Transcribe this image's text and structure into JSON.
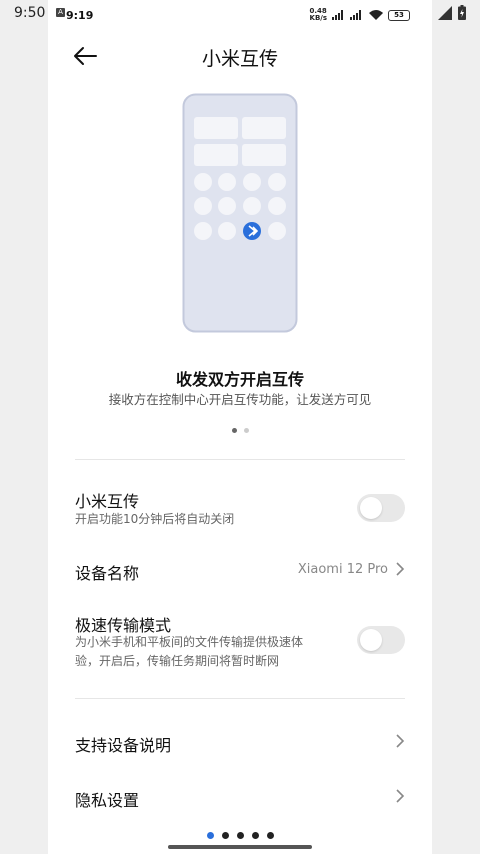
{
  "outer_status": {
    "time": "9:50"
  },
  "inner_status": {
    "time": "9:19",
    "net_speed_top": "0.48",
    "net_speed_bottom": "KB/s",
    "battery": "53"
  },
  "header": {
    "title": "小米互传"
  },
  "slide": {
    "title": "收发双方开启互传",
    "description": "接收方在控制中心开启互传功能，让发送方可见",
    "page_count": 2,
    "active_page": 1
  },
  "settings": {
    "mi_share": {
      "label": "小米互传",
      "sub": "开启功能10分钟后将自动关闭",
      "enabled": false
    },
    "device_name": {
      "label": "设备名称",
      "value": "Xiaomi 12 Pro"
    },
    "fast_mode": {
      "label": "极速传输模式",
      "sub_line1": "为小米手机和平板间的文件传输提供极速体",
      "sub_line2": "验，开启后，传输任务期间将暂时断网",
      "enabled": false
    },
    "supported_devices": {
      "label": "支持设备说明"
    },
    "privacy": {
      "label": "隐私设置"
    }
  },
  "colors": {
    "accent": "#2a6fdb",
    "illustration_bg": "#dfe3ef",
    "illustration_border": "#c3c9dc"
  },
  "bottom_nav": {
    "dot_count": 5,
    "active_dot": 1
  }
}
